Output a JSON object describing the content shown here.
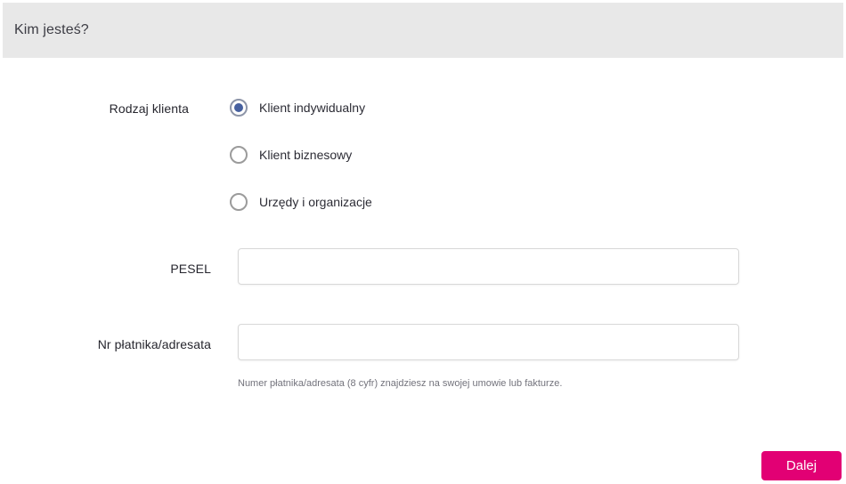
{
  "header": {
    "title": "Kim jesteś?"
  },
  "form": {
    "radio_group": {
      "label": "Rodzaj klienta",
      "options": [
        {
          "label": "Klient indywidualny",
          "selected": true
        },
        {
          "label": "Klient biznesowy",
          "selected": false
        },
        {
          "label": "Urzędy i organizacje",
          "selected": false
        }
      ]
    },
    "fields": [
      {
        "label": "PESEL",
        "value": "",
        "placeholder": ""
      },
      {
        "label": "Nr płatnika/adresata",
        "value": "",
        "placeholder": "",
        "helper": "Numer płatnika/adresata (8 cyfr) znajdziesz na swojej umowie lub fakturze."
      }
    ],
    "submit_label": "Dalej"
  },
  "colors": {
    "accent": "#e20074",
    "header_bg": "#e8e8e8",
    "radio_selected_dot": "#46609f",
    "input_border": "#d8d8d8"
  }
}
